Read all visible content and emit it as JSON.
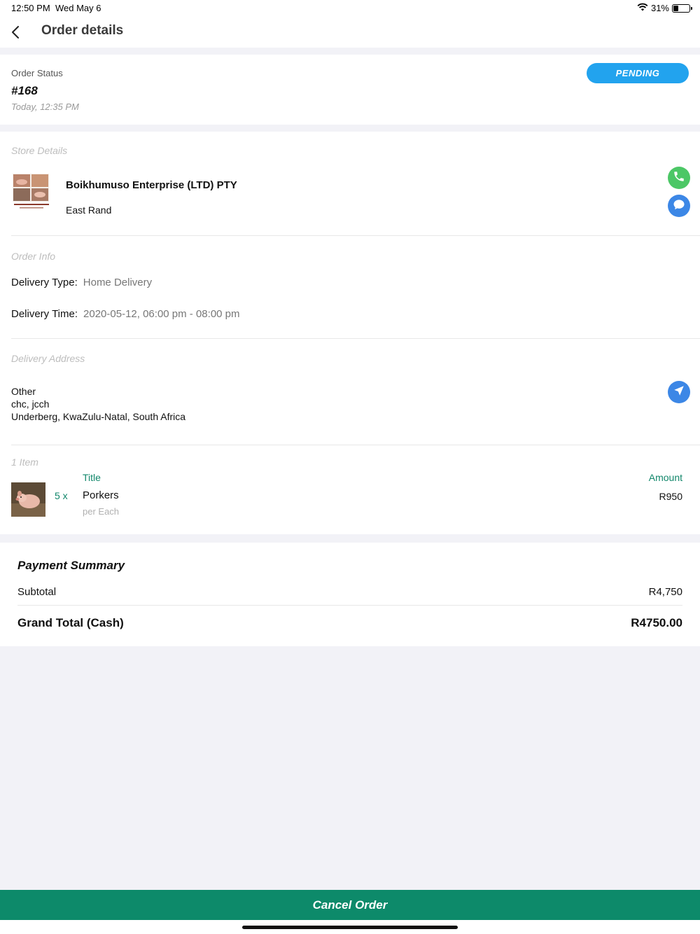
{
  "status_bar": {
    "time": "12:50 PM",
    "date": "Wed May 6",
    "battery_text": "31%",
    "battery_level": 0.31
  },
  "nav": {
    "title": "Order details",
    "back_icon": "chevron-left-icon"
  },
  "order": {
    "status_label": "Order Status",
    "number": "#168",
    "time": "Today, 12:35 PM",
    "status_badge": "PENDING",
    "badge_color": "#22a3ee"
  },
  "store": {
    "section_title": "Store Details",
    "name": "Boikhumuso Enterprise (LTD) PTY",
    "area": "East Rand",
    "logo_caption": "BOIKHUMUSO ENTERPRISE (PTY) LTD",
    "call_icon": "phone-icon",
    "chat_icon": "chat-bubble-icon"
  },
  "order_info": {
    "section_title": "Order Info",
    "delivery_type_label": "Delivery Type:",
    "delivery_type_value": "Home Delivery",
    "delivery_time_label": "Delivery Time:",
    "delivery_time_value": "2020-05-12, 06:00 pm - 08:00 pm"
  },
  "address": {
    "section_title": "Delivery Address",
    "line1": "Other",
    "line2": "chc, jcch",
    "line3": "Underberg, KwaZulu-Natal, South Africa",
    "nav_icon": "navigation-arrow-icon"
  },
  "items": {
    "count_label": "1  Item",
    "col_title": "Title",
    "col_amount": "Amount",
    "rows": [
      {
        "qty": "5 x",
        "name": "Porkers",
        "unit": "per Each",
        "price": "R950"
      }
    ]
  },
  "payment": {
    "title": "Payment Summary",
    "subtotal_label": "Subtotal",
    "subtotal_value": "R4,750",
    "total_label": "Grand Total (Cash)",
    "total_value": "R4750.00"
  },
  "footer": {
    "cancel_label": "Cancel Order",
    "button_color": "#0d8a6a"
  }
}
